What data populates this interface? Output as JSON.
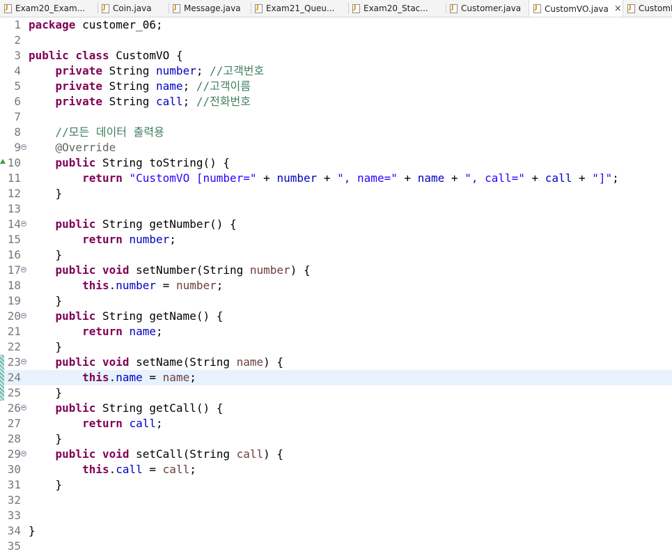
{
  "tabs": [
    {
      "label": "Exam20_Exam...",
      "active": false
    },
    {
      "label": "Coin.java",
      "active": false
    },
    {
      "label": "Message.java",
      "active": false
    },
    {
      "label": "Exam21_Queu...",
      "active": false
    },
    {
      "label": "Exam20_Stac...",
      "active": false
    },
    {
      "label": "Customer.java",
      "active": false
    },
    {
      "label": "CustomVO.java",
      "active": true
    },
    {
      "label": "CustomIn",
      "active": false
    }
  ],
  "close_glyph": "×",
  "current_line": 24,
  "colors": {
    "keyword": "#7f0055",
    "field": "#0000c0",
    "string": "#2a00ff",
    "comment": "#3f7f5f",
    "annotation": "#646464",
    "parameter": "#6a3e3e",
    "current_line_bg": "#e8f2fe"
  },
  "lines": [
    {
      "n": "1",
      "tokens": [
        [
          "kw",
          "package"
        ],
        [
          "p",
          " customer_06;"
        ]
      ]
    },
    {
      "n": "2",
      "tokens": []
    },
    {
      "n": "3",
      "tokens": [
        [
          "kw",
          "public"
        ],
        [
          "p",
          " "
        ],
        [
          "kw",
          "class"
        ],
        [
          "p",
          " CustomVO {"
        ]
      ]
    },
    {
      "n": "4",
      "tokens": [
        [
          "p",
          "    "
        ],
        [
          "kw",
          "private"
        ],
        [
          "p",
          " String "
        ],
        [
          "fld",
          "number"
        ],
        [
          "p",
          "; "
        ],
        [
          "cmt",
          "//고객번호"
        ]
      ]
    },
    {
      "n": "5",
      "tokens": [
        [
          "p",
          "    "
        ],
        [
          "kw",
          "private"
        ],
        [
          "p",
          " String "
        ],
        [
          "fld",
          "name"
        ],
        [
          "p",
          "; "
        ],
        [
          "cmt",
          "//고객이름"
        ]
      ]
    },
    {
      "n": "6",
      "tokens": [
        [
          "p",
          "    "
        ],
        [
          "kw",
          "private"
        ],
        [
          "p",
          " String "
        ],
        [
          "fld",
          "call"
        ],
        [
          "p",
          "; "
        ],
        [
          "cmt",
          "//전화번호"
        ]
      ]
    },
    {
      "n": "7",
      "tokens": []
    },
    {
      "n": "8",
      "tokens": [
        [
          "p",
          "    "
        ],
        [
          "cmt",
          "//모든 데이터 출력용"
        ]
      ]
    },
    {
      "n": "9",
      "fold": true,
      "tokens": [
        [
          "p",
          "    "
        ],
        [
          "ann",
          "@Override"
        ]
      ]
    },
    {
      "n": "10",
      "override": true,
      "tokens": [
        [
          "p",
          "    "
        ],
        [
          "kw",
          "public"
        ],
        [
          "p",
          " String toString() {"
        ]
      ]
    },
    {
      "n": "11",
      "tokens": [
        [
          "p",
          "        "
        ],
        [
          "kw",
          "return"
        ],
        [
          "p",
          " "
        ],
        [
          "str",
          "\"CustomVO [number=\""
        ],
        [
          "p",
          " + "
        ],
        [
          "fld",
          "number"
        ],
        [
          "p",
          " + "
        ],
        [
          "str",
          "\", name=\""
        ],
        [
          "p",
          " + "
        ],
        [
          "fld",
          "name"
        ],
        [
          "p",
          " + "
        ],
        [
          "str",
          "\", call=\""
        ],
        [
          "p",
          " + "
        ],
        [
          "fld",
          "call"
        ],
        [
          "p",
          " + "
        ],
        [
          "str",
          "\"]\""
        ],
        [
          "p",
          ";"
        ]
      ]
    },
    {
      "n": "12",
      "tokens": [
        [
          "p",
          "    }"
        ]
      ]
    },
    {
      "n": "13",
      "tokens": []
    },
    {
      "n": "14",
      "fold": true,
      "tokens": [
        [
          "p",
          "    "
        ],
        [
          "kw",
          "public"
        ],
        [
          "p",
          " String getNumber() {"
        ]
      ]
    },
    {
      "n": "15",
      "tokens": [
        [
          "p",
          "        "
        ],
        [
          "kw",
          "return"
        ],
        [
          "p",
          " "
        ],
        [
          "fld",
          "number"
        ],
        [
          "p",
          ";"
        ]
      ]
    },
    {
      "n": "16",
      "tokens": [
        [
          "p",
          "    }"
        ]
      ]
    },
    {
      "n": "17",
      "fold": true,
      "tokens": [
        [
          "p",
          "    "
        ],
        [
          "kw",
          "public"
        ],
        [
          "p",
          " "
        ],
        [
          "kw",
          "void"
        ],
        [
          "p",
          " setNumber(String "
        ],
        [
          "par",
          "number"
        ],
        [
          "p",
          ") {"
        ]
      ]
    },
    {
      "n": "18",
      "tokens": [
        [
          "p",
          "        "
        ],
        [
          "kw",
          "this"
        ],
        [
          "p",
          "."
        ],
        [
          "fld",
          "number"
        ],
        [
          "p",
          " = "
        ],
        [
          "par",
          "number"
        ],
        [
          "p",
          ";"
        ]
      ]
    },
    {
      "n": "19",
      "tokens": [
        [
          "p",
          "    }"
        ]
      ]
    },
    {
      "n": "20",
      "fold": true,
      "tokens": [
        [
          "p",
          "    "
        ],
        [
          "kw",
          "public"
        ],
        [
          "p",
          " String getName() {"
        ]
      ]
    },
    {
      "n": "21",
      "tokens": [
        [
          "p",
          "        "
        ],
        [
          "kw",
          "return"
        ],
        [
          "p",
          " "
        ],
        [
          "fld",
          "name"
        ],
        [
          "p",
          ";"
        ]
      ]
    },
    {
      "n": "22",
      "tokens": [
        [
          "p",
          "    }"
        ]
      ]
    },
    {
      "n": "23",
      "fold": true,
      "mark": true,
      "tokens": [
        [
          "p",
          "    "
        ],
        [
          "kw",
          "public"
        ],
        [
          "p",
          " "
        ],
        [
          "kw",
          "void"
        ],
        [
          "p",
          " setName(String "
        ],
        [
          "par",
          "name"
        ],
        [
          "p",
          ") {"
        ]
      ]
    },
    {
      "n": "24",
      "mark": true,
      "tokens": [
        [
          "p",
          "        "
        ],
        [
          "kw",
          "this"
        ],
        [
          "p",
          "."
        ],
        [
          "fld",
          "name"
        ],
        [
          "p",
          " = "
        ],
        [
          "par",
          "name"
        ],
        [
          "p",
          ";"
        ]
      ]
    },
    {
      "n": "25",
      "mark": true,
      "tokens": [
        [
          "p",
          "    }"
        ]
      ]
    },
    {
      "n": "26",
      "fold": true,
      "tokens": [
        [
          "p",
          "    "
        ],
        [
          "kw",
          "public"
        ],
        [
          "p",
          " String getCall() {"
        ]
      ]
    },
    {
      "n": "27",
      "tokens": [
        [
          "p",
          "        "
        ],
        [
          "kw",
          "return"
        ],
        [
          "p",
          " "
        ],
        [
          "fld",
          "call"
        ],
        [
          "p",
          ";"
        ]
      ]
    },
    {
      "n": "28",
      "tokens": [
        [
          "p",
          "    }"
        ]
      ]
    },
    {
      "n": "29",
      "fold": true,
      "tokens": [
        [
          "p",
          "    "
        ],
        [
          "kw",
          "public"
        ],
        [
          "p",
          " "
        ],
        [
          "kw",
          "void"
        ],
        [
          "p",
          " setCall(String "
        ],
        [
          "par",
          "call"
        ],
        [
          "p",
          ") {"
        ]
      ]
    },
    {
      "n": "30",
      "tokens": [
        [
          "p",
          "        "
        ],
        [
          "kw",
          "this"
        ],
        [
          "p",
          "."
        ],
        [
          "fld",
          "call"
        ],
        [
          "p",
          " = "
        ],
        [
          "par",
          "call"
        ],
        [
          "p",
          ";"
        ]
      ]
    },
    {
      "n": "31",
      "tokens": [
        [
          "p",
          "    }"
        ]
      ]
    },
    {
      "n": "32",
      "tokens": []
    },
    {
      "n": "33",
      "tokens": []
    },
    {
      "n": "34",
      "tokens": [
        [
          "p",
          "}"
        ]
      ]
    },
    {
      "n": "35",
      "tokens": []
    }
  ]
}
